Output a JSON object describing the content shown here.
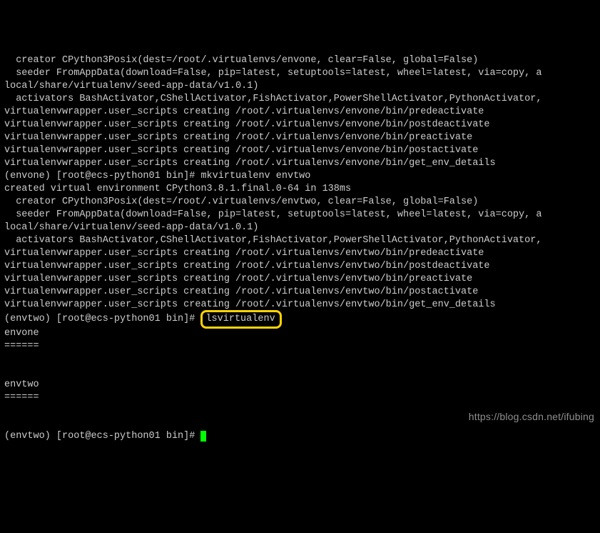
{
  "lines": [
    "  creator CPython3Posix(dest=/root/.virtualenvs/envone, clear=False, global=False)",
    "  seeder FromAppData(download=False, pip=latest, setuptools=latest, wheel=latest, via=copy, a",
    "local/share/virtualenv/seed-app-data/v1.0.1)",
    "  activators BashActivator,CShellActivator,FishActivator,PowerShellActivator,PythonActivator,",
    "virtualenvwrapper.user_scripts creating /root/.virtualenvs/envone/bin/predeactivate",
    "virtualenvwrapper.user_scripts creating /root/.virtualenvs/envone/bin/postdeactivate",
    "virtualenvwrapper.user_scripts creating /root/.virtualenvs/envone/bin/preactivate",
    "virtualenvwrapper.user_scripts creating /root/.virtualenvs/envone/bin/postactivate",
    "virtualenvwrapper.user_scripts creating /root/.virtualenvs/envone/bin/get_env_details",
    "(envone) [root@ecs-python01 bin]# mkvirtualenv envtwo",
    "created virtual environment CPython3.8.1.final.0-64 in 138ms",
    "  creator CPython3Posix(dest=/root/.virtualenvs/envtwo, clear=False, global=False)",
    "  seeder FromAppData(download=False, pip=latest, setuptools=latest, wheel=latest, via=copy, a",
    "local/share/virtualenv/seed-app-data/v1.0.1)",
    "  activators BashActivator,CShellActivator,FishActivator,PowerShellActivator,PythonActivator,",
    "virtualenvwrapper.user_scripts creating /root/.virtualenvs/envtwo/bin/predeactivate",
    "virtualenvwrapper.user_scripts creating /root/.virtualenvs/envtwo/bin/postdeactivate",
    "virtualenvwrapper.user_scripts creating /root/.virtualenvs/envtwo/bin/preactivate",
    "virtualenvwrapper.user_scripts creating /root/.virtualenvs/envtwo/bin/postactivate",
    "virtualenvwrapper.user_scripts creating /root/.virtualenvs/envtwo/bin/get_env_details"
  ],
  "prompt_highlight_prefix": "(envtwo) [root@ecs-python01 bin]# ",
  "highlighted_command": "lsvirtualenv",
  "output_lines": [
    "envone",
    "======",
    "",
    "",
    "envtwo",
    "======",
    "",
    ""
  ],
  "final_prompt": "(envtwo) [root@ecs-python01 bin]# ",
  "watermark": "https://blog.csdn.net/ifubing"
}
